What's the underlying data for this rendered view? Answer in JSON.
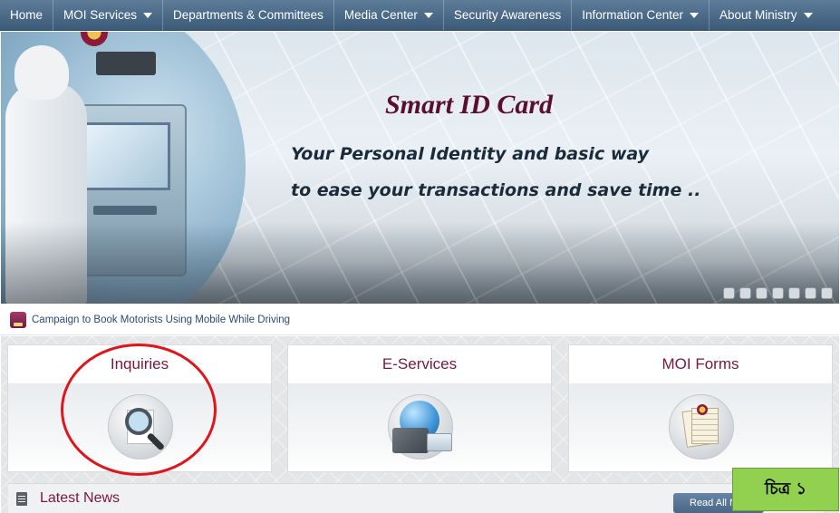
{
  "nav": {
    "items": [
      {
        "label": "Home",
        "dropdown": false
      },
      {
        "label": "MOI Services",
        "dropdown": true
      },
      {
        "label": "Departments & Committees",
        "dropdown": false
      },
      {
        "label": "Media Center",
        "dropdown": true
      },
      {
        "label": "Security Awareness",
        "dropdown": false
      },
      {
        "label": "Information Center",
        "dropdown": true
      },
      {
        "label": "About Ministry",
        "dropdown": true
      }
    ]
  },
  "hero": {
    "title": "Smart ID Card",
    "line1": "Your Personal Identity and basic way",
    "line2": "to ease your transactions and save time ..",
    "slide_count": 7
  },
  "ticker": {
    "text": "Campaign to Book Motorists Using Mobile While Driving"
  },
  "tiles": [
    {
      "label": "Inquiries",
      "icon": "magnifier-document-icon"
    },
    {
      "label": "E-Services",
      "icon": "globe-card-icon"
    },
    {
      "label": "MOI Forms",
      "icon": "forms-icon"
    }
  ],
  "news": {
    "title": "Latest News",
    "read_all": "Read All N"
  },
  "figure_label": "চিত্র ১",
  "colors": {
    "nav": "#3c5b78",
    "accent": "#7a1838",
    "highlight": "#e0151b",
    "label_bg": "#92d050"
  }
}
